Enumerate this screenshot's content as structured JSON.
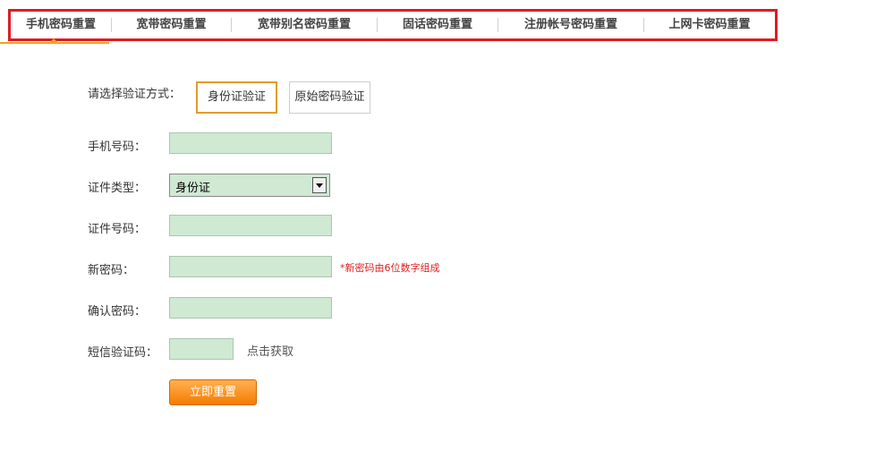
{
  "tabs": [
    {
      "label": "手机密码重置"
    },
    {
      "label": "宽带密码重置"
    },
    {
      "label": "宽带别名密码重置"
    },
    {
      "label": "固话密码重置"
    },
    {
      "label": "注册帐号密码重置"
    },
    {
      "label": "上网卡密码重置"
    }
  ],
  "form": {
    "verify_label": "请选择验证方式：",
    "verify_options": [
      "身份证验证",
      "原始密码验证"
    ],
    "phone_label": "手机号码：",
    "id_type_label": "证件类型：",
    "id_type_value": "身份证",
    "id_number_label": "证件号码：",
    "new_password_label": "新密码：",
    "new_password_hint": "*新密码由6位数字组成",
    "confirm_password_label": "确认密码：",
    "sms_code_label": "短信验证码：",
    "get_code_link": "点击获取",
    "submit_label": "立即重置"
  },
  "colors": {
    "tab_highlight_border": "#e01b24",
    "active_accent": "#f0a020",
    "field_bg": "#cfe9d3",
    "hint": "#e02020",
    "button": "#f47c00"
  }
}
